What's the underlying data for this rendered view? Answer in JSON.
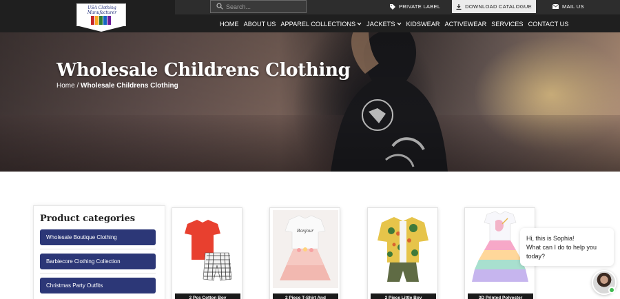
{
  "header": {
    "logo_text": "USA Clothing Manufacturer",
    "search_placeholder": "Search...",
    "top_links": {
      "private_label": "PRIVATE LABEL",
      "download_catalogue": "DOWNLOAD CATALOGUE",
      "mail_us": "MAIL US"
    },
    "nav": [
      {
        "label": "HOME"
      },
      {
        "label": "ABOUT US"
      },
      {
        "label": "APPAREL COLLECTIONS",
        "has_dropdown": true
      },
      {
        "label": "JACKETS",
        "has_dropdown": true
      },
      {
        "label": "KIDSWEAR"
      },
      {
        "label": "ACTIVEWEAR"
      },
      {
        "label": "SERVICES"
      },
      {
        "label": "CONTACT US"
      }
    ]
  },
  "hero": {
    "title": "Wholesale Childrens Clothing",
    "breadcrumb_home": "Home",
    "breadcrumb_sep": " / ",
    "breadcrumb_current": "Wholesale Childrens Clothing"
  },
  "sidebar": {
    "title": "Product categories",
    "categories": [
      "Wholesale Boutique Clothing",
      "Barbiecore Clothing Collection",
      "Christmas Party Outfits"
    ]
  },
  "products": [
    {
      "name": "2 Pcs Cotton Boy",
      "icon": "red-tshirt-checked-shorts-image"
    },
    {
      "name": "2 Piece T-Shirt And",
      "icon": "white-tshirt-pink-tutu-image"
    },
    {
      "name": "2 Piece Little Boy",
      "icon": "tropical-shirt-khaki-shorts-image"
    },
    {
      "name": "3D Printed Polyester",
      "icon": "unicorn-rainbow-dress-image"
    }
  ],
  "chat": {
    "message_line1": "Hi, this is Sophia!",
    "message_line2": "What can I do to help you today?"
  },
  "colors": {
    "header_bg": "#1f1f1f",
    "category_button": "#2c3777",
    "card_label_bg": "#1a1a1a"
  }
}
